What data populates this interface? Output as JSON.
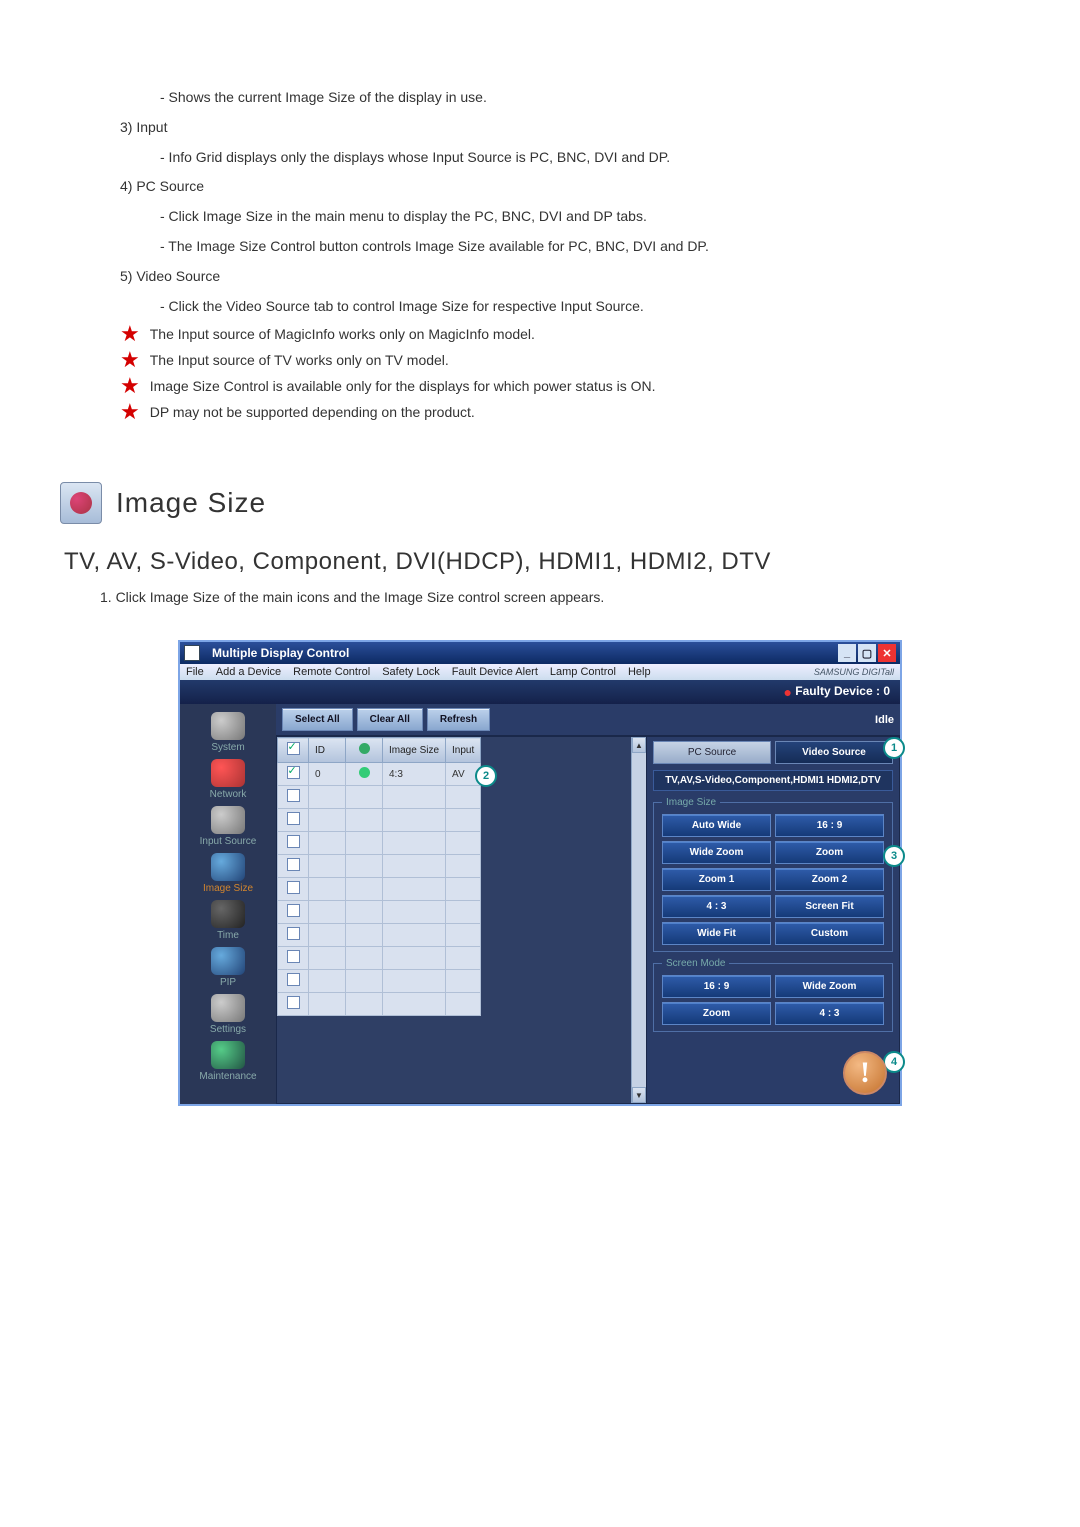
{
  "doc": {
    "line1": "- Shows the current Image Size of the display in use.",
    "item3": "3) Input",
    "item3a": "- Info Grid displays only the displays whose Input Source is PC, BNC, DVI and DP.",
    "item4": "4) PC Source",
    "item4a": "- Click Image Size in the main menu to display the PC, BNC, DVI and DP tabs.",
    "item4b": "- The Image Size Control button controls Image Size available for PC, BNC, DVI and DP.",
    "item5": "5) Video Source",
    "item5a": "- Click the Video Source tab to control Image Size for respective Input Source.",
    "star1": "The Input source of MagicInfo works only on MagicInfo model.",
    "star2": "The Input source of TV works only on TV model.",
    "star3": "Image Size Control is available only for the displays for which power status is ON.",
    "star4": "DP may not be supported depending on the product.",
    "section_title": "Image Size",
    "subhead": "TV, AV, S-Video, Component, DVI(HDCP), HDMI1, HDMI2, DTV",
    "step1": "1.  Click Image Size of the main icons and the Image Size control screen appears."
  },
  "app": {
    "title": "Multiple Display Control",
    "menu": [
      "File",
      "Add a Device",
      "Remote Control",
      "Safety Lock",
      "Fault Device Alert",
      "Lamp Control",
      "Help"
    ],
    "brand": "SAMSUNG DIGITall",
    "faulty_label": "Faulty Device : 0",
    "top_buttons": [
      "Select All",
      "Clear All",
      "Refresh"
    ],
    "idle": "Idle",
    "sidebar": [
      {
        "label": "System",
        "color": "grey",
        "active": false
      },
      {
        "label": "Network",
        "color": "red",
        "active": false
      },
      {
        "label": "Input Source",
        "color": "grey",
        "active": false
      },
      {
        "label": "Image Size",
        "color": "blue",
        "active": true
      },
      {
        "label": "Time",
        "color": "dark",
        "active": false
      },
      {
        "label": "PIP",
        "color": "blue",
        "active": false
      },
      {
        "label": "Settings",
        "color": "grey",
        "active": false
      },
      {
        "label": "Maintenance",
        "color": "green",
        "active": false
      }
    ],
    "columns": {
      "id": "ID",
      "image_size": "Image Size",
      "input": "Input"
    },
    "row": {
      "id": "0",
      "image_size": "4:3",
      "input": "AV"
    },
    "tabs": {
      "pc": "PC Source",
      "video": "Video Source"
    },
    "info_strip": "TV,AV,S-Video,Component,HDMI1 HDMI2,DTV",
    "fs_image_size": "Image Size",
    "image_size_btns": [
      "Auto Wide",
      "16 : 9",
      "Wide Zoom",
      "Zoom",
      "Zoom 1",
      "Zoom 2",
      "4 : 3",
      "Screen Fit",
      "Wide Fit",
      "Custom"
    ],
    "fs_screen_mode": "Screen Mode",
    "screen_mode_btns": [
      "16 : 9",
      "Wide Zoom",
      "Zoom",
      "4 : 3"
    ],
    "callouts": {
      "c1": "1",
      "c2": "2",
      "c3": "3",
      "c4": "4"
    }
  }
}
